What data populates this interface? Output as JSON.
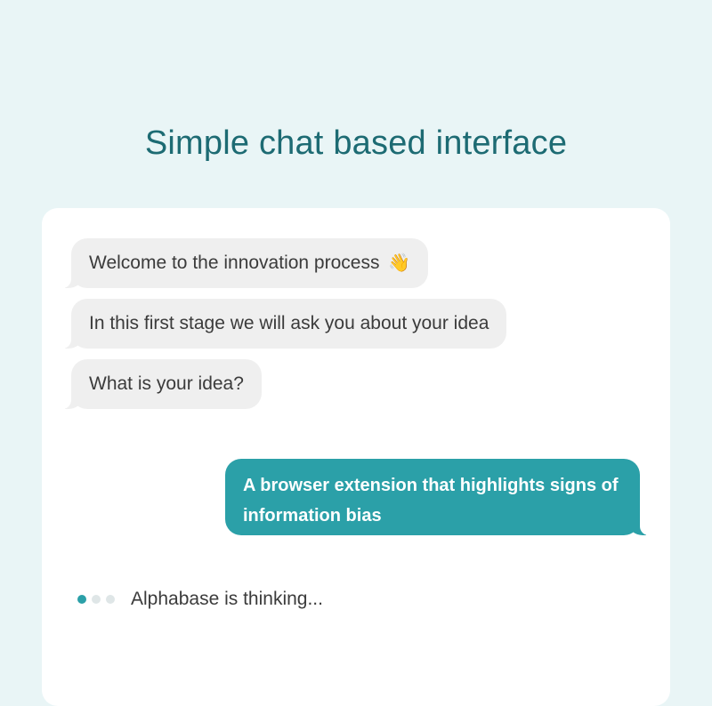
{
  "header": {
    "title": "Simple chat based interface"
  },
  "chat": {
    "messages": [
      {
        "text": "Welcome to the innovation process",
        "emoji": "👋"
      },
      {
        "text": "In this first stage we will ask you about your idea"
      },
      {
        "text": "What is your idea?"
      }
    ],
    "reply": {
      "text": "A browser extension that highlights signs of information bias"
    },
    "status": {
      "text": "Alphabase is thinking..."
    }
  },
  "colors": {
    "background": "#e9f5f6",
    "title": "#1d6b73",
    "accent": "#2ba0a8",
    "incoming_bubble": "#efefef"
  }
}
